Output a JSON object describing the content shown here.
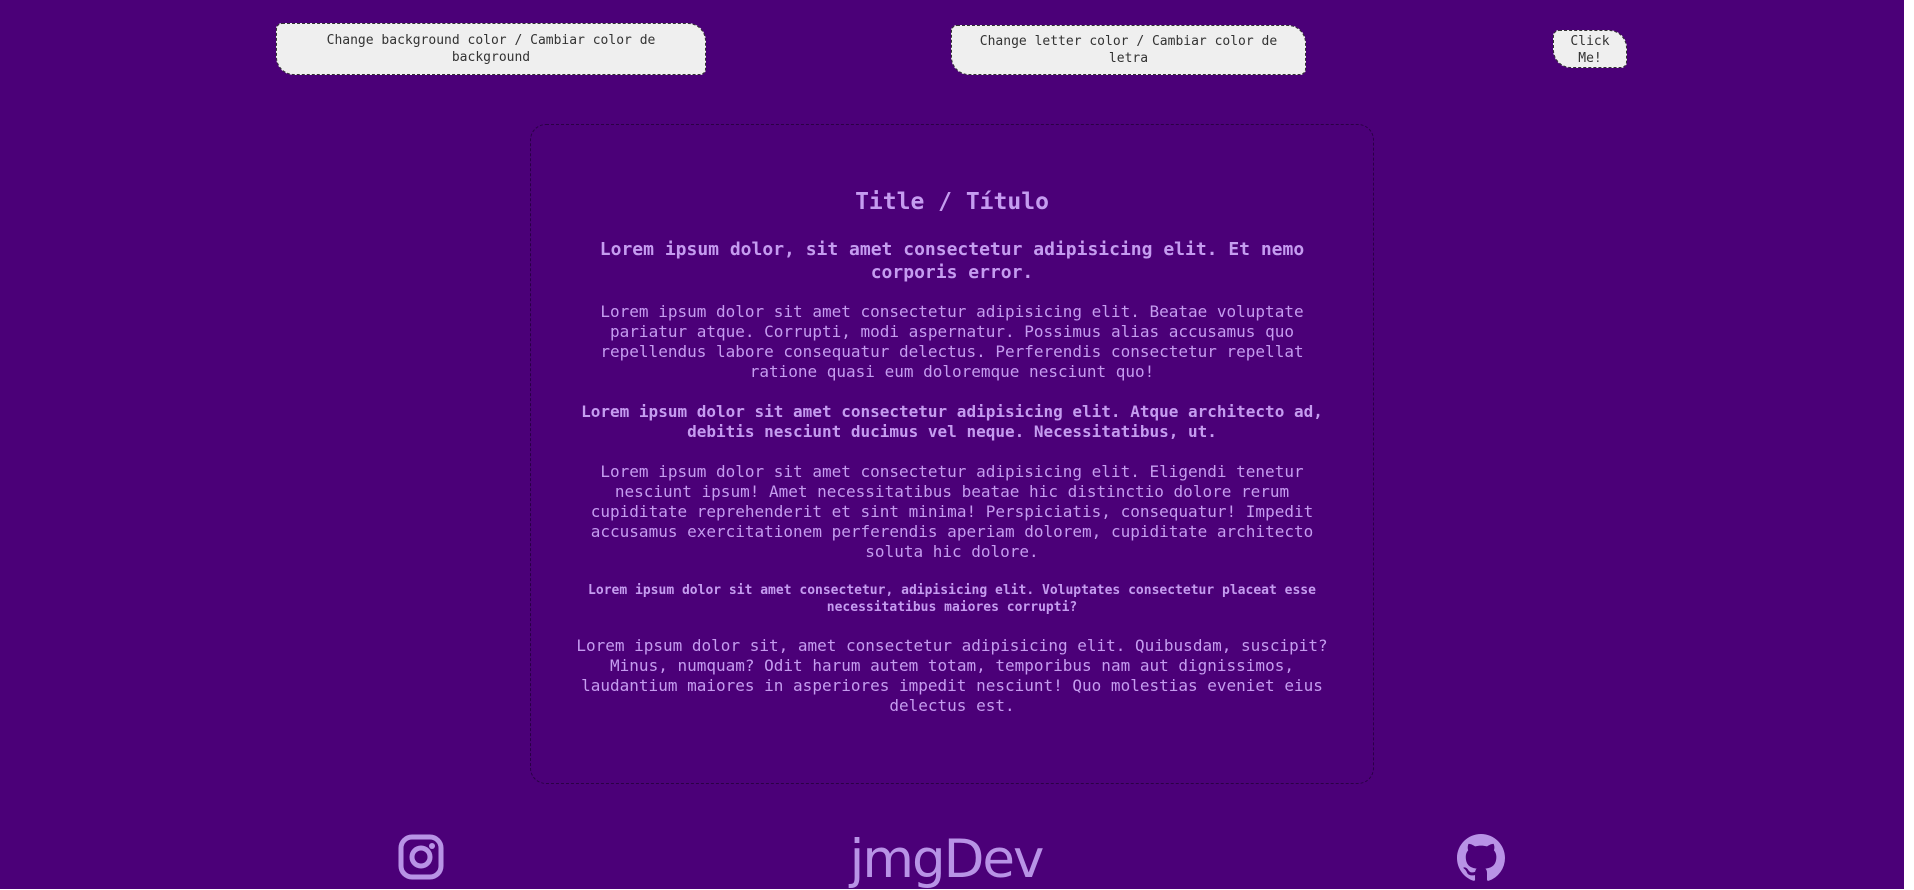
{
  "controls": {
    "change_background_label": "Change background color / Cambiar color de background",
    "change_letter_label": "Change letter color / Cambiar color de letra",
    "click_me_label": "Click Me!"
  },
  "content": {
    "title": "Title / Título",
    "heading_2": "Lorem ipsum dolor, sit amet consectetur adipisicing elit. Et nemo corporis error.",
    "paragraph_1": "Lorem ipsum dolor sit amet consectetur adipisicing elit. Beatae voluptate pariatur atque. Corrupti, modi aspernatur. Possimus alias accusamus quo repellendus labore consequatur delectus. Perferendis consectetur repellat ratione quasi eum doloremque nesciunt quo!",
    "heading_3": "Lorem ipsum dolor sit amet consectetur adipisicing elit. Atque architecto ad, debitis nesciunt ducimus vel neque. Necessitatibus, ut.",
    "paragraph_2": "Lorem ipsum dolor sit amet consectetur adipisicing elit. Eligendi tenetur nesciunt ipsum! Amet necessitatibus beatae hic distinctio dolore rerum cupiditate reprehenderit et sint minima! Perspiciatis, consequatur! Impedit accusamus exercitationem perferendis aperiam dolorem, cupiditate architecto soluta hic dolore.",
    "heading_4": "Lorem ipsum dolor sit amet consectetur, adipisicing elit. Voluptates consectetur placeat esse necessitatibus maiores corrupti?",
    "paragraph_3": "Lorem ipsum dolor sit, amet consectetur adipisicing elit. Quibusdam, suscipit? Minus, numquam? Odit harum autem totam, temporibus nam aut dignissimos, laudantium maiores in asperiores impedit nesciunt! Quo molestias eveniet eius delectus est."
  },
  "footer": {
    "brand": "jmgDev",
    "icons": [
      "instagram-icon",
      "github-icon"
    ]
  },
  "colors": {
    "background": "#4b0078",
    "text": "#c59cf0",
    "button_background": "#efefef",
    "button_text": "#333333"
  }
}
